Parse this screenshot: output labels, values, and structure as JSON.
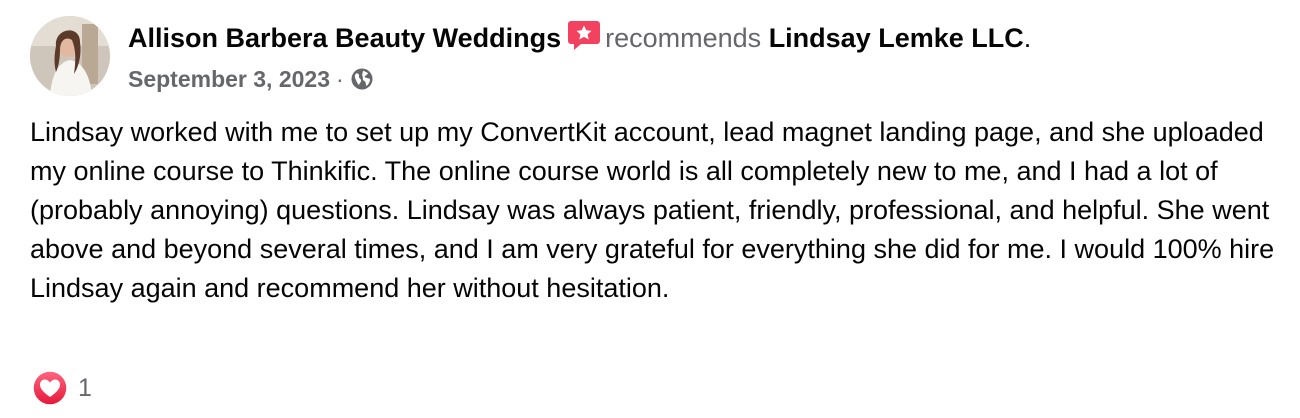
{
  "post": {
    "author_name": "Allison Barbera Beauty Weddings",
    "recommends_text": "recommends",
    "target_name": "Lindsay Lemke LLC",
    "period": ".",
    "date": "September 3, 2023",
    "separator": "·",
    "audience_icon": "globe-icon",
    "recommend_icon": "recommendation-star-icon",
    "body": "Lindsay worked with me to set up my ConvertKit account, lead magnet landing page, and she uploaded my online course to Thinkific. The online course world is all completely new to me, and I had a lot of (probably annoying) questions. Lindsay was always patient, friendly, professional, and helpful. She went above and beyond several times, and I am very grateful for everything she did for me. I would 100% hire Lindsay again and recommend her without hesitation.",
    "reaction_icon": "love-reaction-icon",
    "reaction_count": "1"
  },
  "colors": {
    "text_primary": "#050505",
    "text_secondary": "#65676b",
    "recommend_accent": "#f3425f",
    "love_accent": "#f02849"
  }
}
